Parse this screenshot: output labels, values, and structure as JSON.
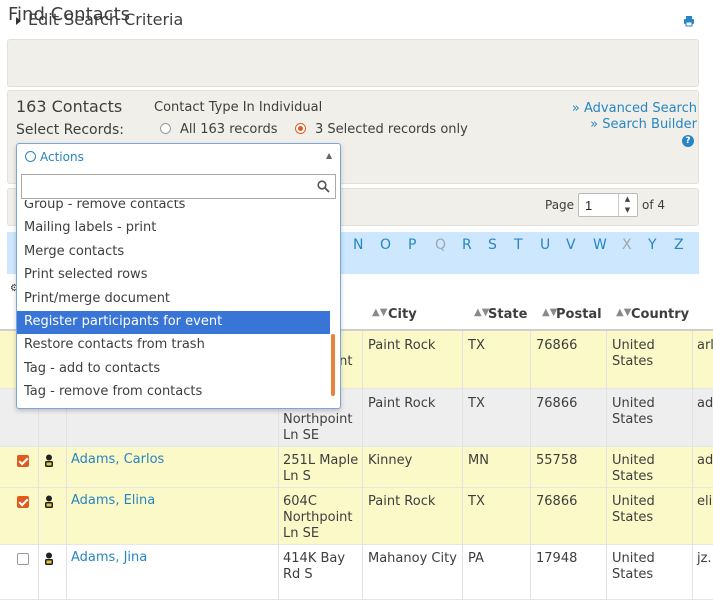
{
  "page": {
    "title": "Find Contacts"
  },
  "criteria": {
    "label": "Edit Search Criteria"
  },
  "summary": {
    "count": "163 Contacts",
    "contact_type": "Contact Type In Individual",
    "select_records": "Select Records:",
    "option_all": "All 163 records",
    "option_selected": "3 Selected records only",
    "selected_option": "option_selected",
    "advanced_search": "» Advanced Search",
    "search_builder": "» Search Builder"
  },
  "actions": {
    "label": "Actions",
    "search_value": "",
    "options": [
      "Group - remove contacts",
      "Mailing labels - print",
      "Merge contacts",
      "Print selected rows",
      "Print/merge document",
      "Register participants for event",
      "Restore contacts from trash",
      "Tag - add to contacts",
      "Tag - remove from contacts"
    ],
    "highlighted": "Register participants for event"
  },
  "pager": {
    "page_label": "Page",
    "page_value": "1",
    "of_label": "of 4"
  },
  "alphabet": {
    "letters": [
      "N",
      "O",
      "P",
      "Q",
      "R",
      "S",
      "T",
      "U",
      "V",
      "W",
      "X",
      "Y",
      "Z"
    ],
    "disabled": [
      "Q",
      "X"
    ]
  },
  "table": {
    "columns": [
      "City",
      "State",
      "Postal",
      "Country"
    ],
    "rows": [
      {
        "selected": false,
        "name": "",
        "address": [
          "",
          "Northpoint",
          ""
        ],
        "city": "Paint Rock",
        "state": "TX",
        "postal": "76866",
        "country": [
          "United",
          "States"
        ],
        "email": "arl"
      },
      {
        "selected": false,
        "name": "",
        "address": [
          "Northpoint",
          "Ln SE"
        ],
        "city": "Paint Rock",
        "state": "TX",
        "postal": "76866",
        "country": [
          "United",
          "States"
        ],
        "email": "ad"
      },
      {
        "selected": true,
        "name": "Adams, Carlos",
        "address": [
          "251L Maple",
          "Ln S"
        ],
        "city": "Kinney",
        "state": "MN",
        "postal": "55758",
        "country": [
          "United",
          "States"
        ],
        "email": "ad"
      },
      {
        "selected": true,
        "name": "Adams, Elina",
        "address": [
          "604C",
          "Northpoint",
          "Ln SE"
        ],
        "city": "Paint Rock",
        "state": "TX",
        "postal": "76866",
        "country": [
          "United",
          "States"
        ],
        "email": "eli"
      },
      {
        "selected": false,
        "name": "Adams, Jina",
        "address": [
          "414K Bay",
          "Rd S"
        ],
        "city": "Mahanoy City",
        "state": "PA",
        "postal": "17948",
        "country": [
          "United",
          "States"
        ],
        "email": "jz."
      }
    ]
  },
  "colors": {
    "link": "#2786c2",
    "accent": "#e05a20",
    "highlight_row": "#fbf9c8",
    "alpha_bar": "#cde8fe",
    "option_active": "#3875d7"
  }
}
